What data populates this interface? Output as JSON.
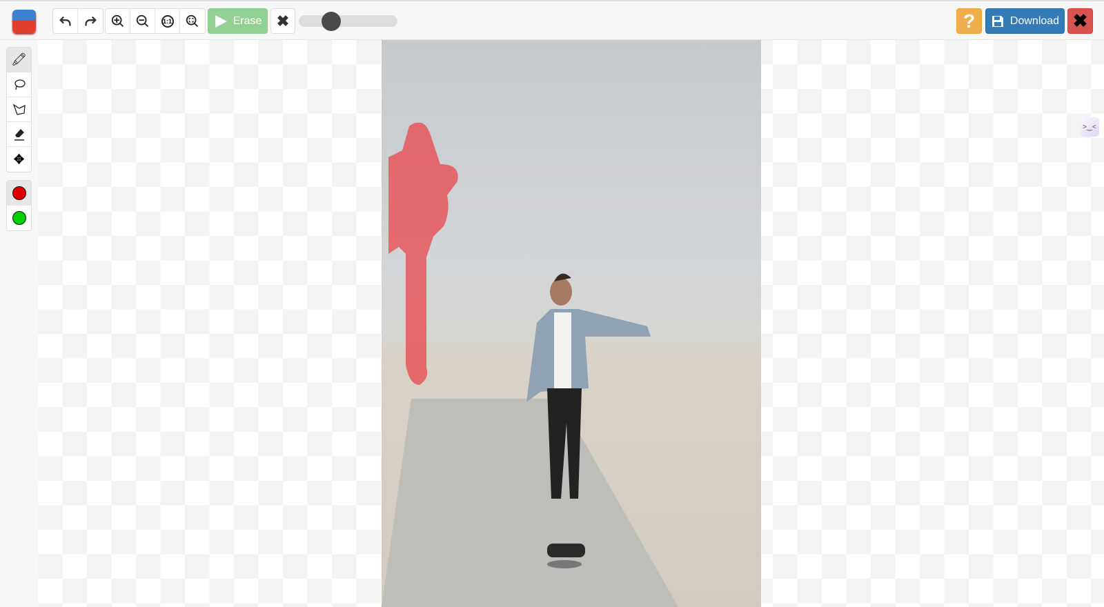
{
  "toolbar": {
    "logo": "app-logo",
    "undo_icon": "undo-icon",
    "redo_icon": "redo-icon",
    "zoom_in_icon": "zoom-in-icon",
    "zoom_out_icon": "zoom-out-icon",
    "zoom_actual_label": "1:1",
    "zoom_fit_icon": "zoom-fit-icon",
    "erase_label": "Erase",
    "clear_label": "✖",
    "brush_size_percent": 30,
    "help_label": "?",
    "download_label": "Download",
    "close_label": "✖"
  },
  "tools": [
    {
      "name": "marker",
      "icon": "marker-icon",
      "active": true
    },
    {
      "name": "lasso",
      "icon": "lasso-icon",
      "active": false
    },
    {
      "name": "polygon-lasso",
      "icon": "polygon-lasso-icon",
      "active": false
    },
    {
      "name": "eraser",
      "icon": "eraser-icon",
      "active": false
    },
    {
      "name": "move",
      "icon": "move-icon",
      "active": false
    }
  ],
  "colors": [
    {
      "name": "remove",
      "hex": "#e00000",
      "active": true
    },
    {
      "name": "keep",
      "hex": "#00d000",
      "active": false
    }
  ],
  "colors_theme": {
    "erase_button": "#93d093",
    "download_button": "#337ab7",
    "help_button": "#f0ad4e",
    "close_button": "#d9534f",
    "mask": "#e8464c"
  },
  "widget": {
    "face": ">‿<"
  }
}
